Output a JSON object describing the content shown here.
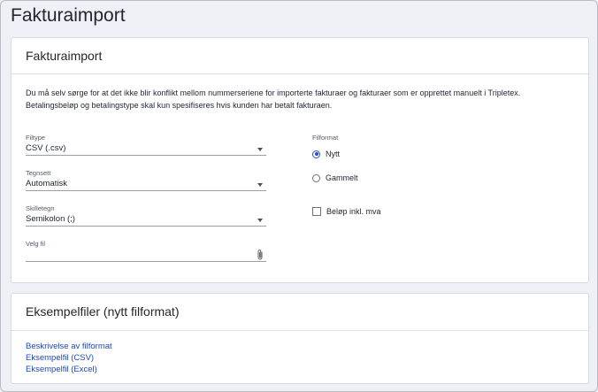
{
  "page": {
    "title": "Fakturaimport"
  },
  "import_card": {
    "title": "Fakturaimport",
    "intro_line1": "Du må selv sørge for at det ikke blir konflikt mellom nummerseriene for importerte fakturaer og fakturaer som er opprettet manuelt i Tripletex.",
    "intro_line2": "Betalingsbeløp og betalingstype skal kun spesifiseres hvis kunden har betalt fakturaen.",
    "filtype": {
      "label": "Filtype",
      "value": "CSV (.csv)"
    },
    "tegnsett": {
      "label": "Tegnsett",
      "value": "Automatisk"
    },
    "skilletegn": {
      "label": "Skilletegn",
      "value": "Semikolon (;)"
    },
    "velg_fil": {
      "label": "Velg fil",
      "value": ""
    },
    "filformat": {
      "label": "Filformat",
      "options": [
        {
          "label": "Nytt",
          "selected": true
        },
        {
          "label": "Gammelt",
          "selected": false
        }
      ]
    },
    "belop_inkl_mva": {
      "label": "Beløp inkl. mva",
      "checked": false
    }
  },
  "examples_card": {
    "title": "Eksempelfiler (nytt filformat)",
    "links": [
      "Beskrivelse av filformat",
      "Eksempelfil (CSV)",
      "Eksempelfil (Excel)"
    ]
  },
  "colors": {
    "accent": "#2350c8",
    "link": "#1f48b8",
    "background": "#eef0f5"
  },
  "icons": {
    "attach": "paperclip-icon",
    "dropdown": "chevron-down-icon"
  }
}
